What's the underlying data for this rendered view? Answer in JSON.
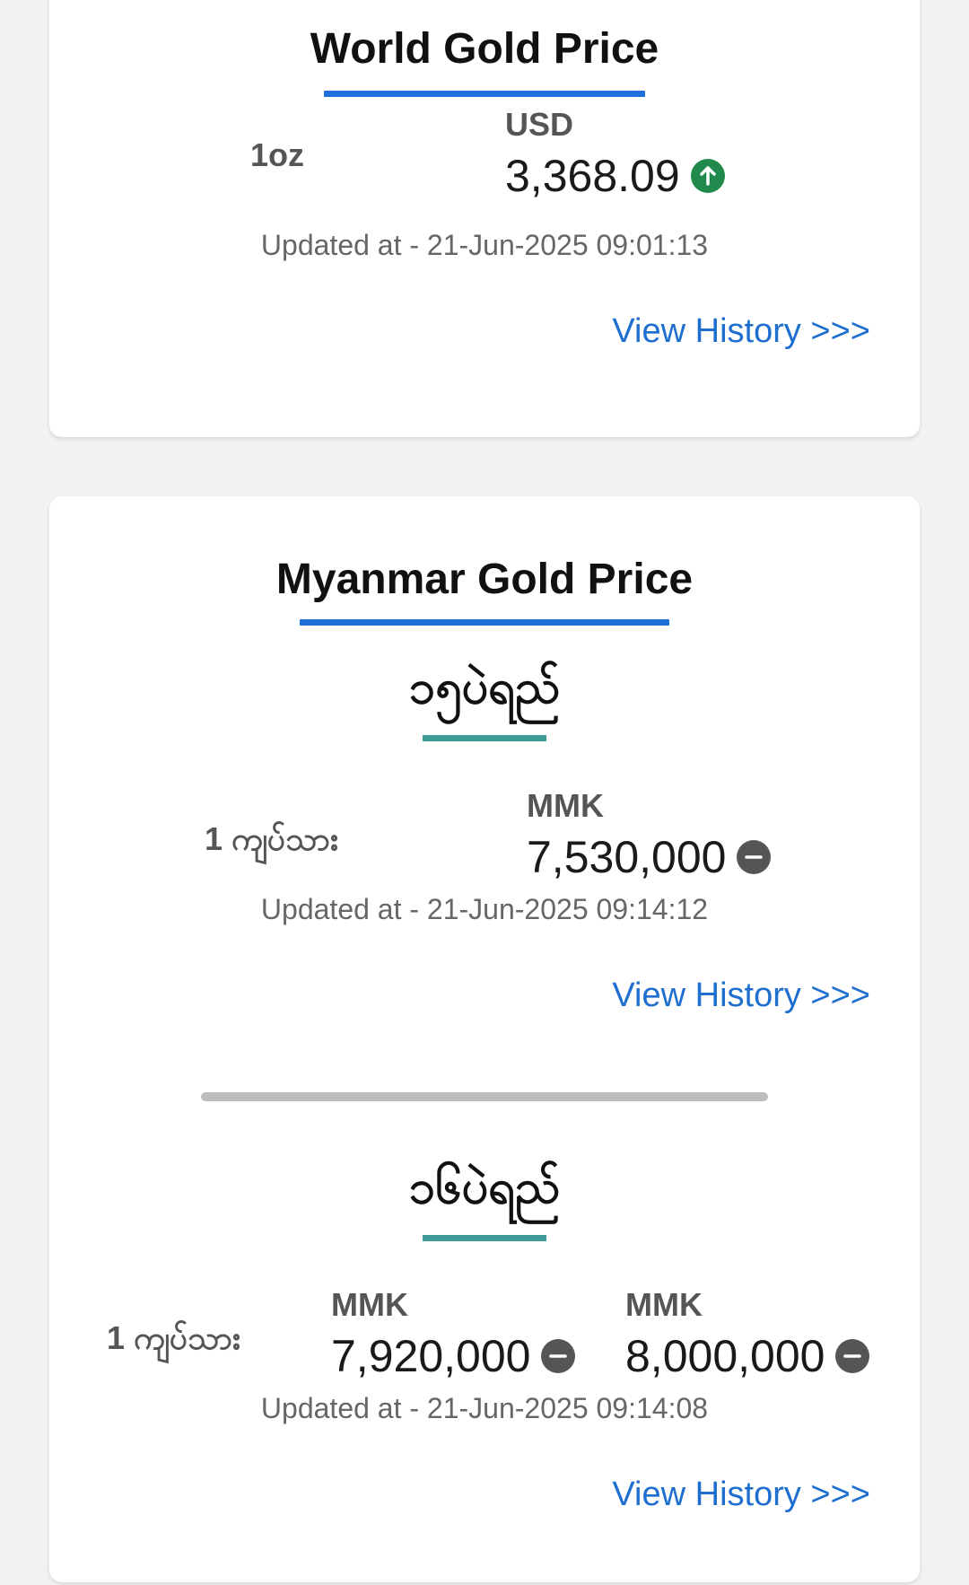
{
  "world": {
    "title": "World Gold Price",
    "unit": "1oz",
    "currency": "USD",
    "price": "3,368.09",
    "trend_icon": "arrow-up-circle-icon",
    "updated": "Updated at - 21-Jun-2025 09:01:13",
    "view_history": "View History >>>"
  },
  "myanmar": {
    "title": "Myanmar Gold Price",
    "sections": [
      {
        "title": "၁၅ပဲရည်",
        "unit": "1 ကျပ်သား",
        "prices": [
          {
            "currency": "MMK",
            "value": "7,530,000",
            "trend_icon": "minus-circle-icon"
          }
        ],
        "updated": "Updated at - 21-Jun-2025 09:14:12",
        "view_history": "View History >>>"
      },
      {
        "title": "၁၆ပဲရည်",
        "unit": "1 ကျပ်သား",
        "prices": [
          {
            "currency": "MMK",
            "value": "7,920,000",
            "trend_icon": "minus-circle-icon"
          },
          {
            "currency": "MMK",
            "value": "8,000,000",
            "trend_icon": "minus-circle-icon"
          }
        ],
        "updated": "Updated at - 21-Jun-2025 09:14:08",
        "view_history": "View History >>>"
      }
    ]
  },
  "colors": {
    "accent_blue": "#1e6fdb",
    "accent_teal": "#3f9b96",
    "trend_up": "#1f8a4c",
    "trend_neutral": "#555555",
    "link": "#1e6fcf"
  }
}
